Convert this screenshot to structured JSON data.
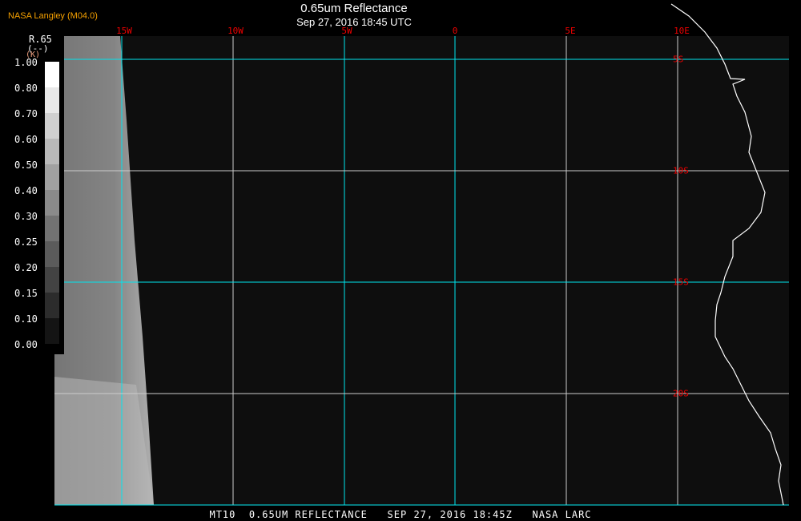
{
  "credit": "NASA Langley (M04.0)",
  "title": "0.65um Reflectance",
  "subtitle": "Sep 27, 2016 18:45 UTC",
  "legend": {
    "var": "R.65",
    "units": "(--)",
    "sub": "(K)",
    "values": [
      "1.00",
      "0.80",
      "0.70",
      "0.60",
      "0.50",
      "0.40",
      "0.30",
      "0.25",
      "0.20",
      "0.15",
      "0.10",
      "0.00"
    ]
  },
  "lon_labels": [
    "15W",
    "10W",
    "5W",
    "0",
    "5E",
    "10E"
  ],
  "lat_labels": [
    "5S",
    "10S",
    "15S",
    "20S"
  ],
  "footer": "MT10  0.65UM REFLECTANCE   SEP 27, 2016 18:45Z   NASA LARC",
  "colors": {
    "grid_major": "#00e5ee",
    "grid_minor": "#cccccc",
    "label": "#ee0000",
    "credit": "#f5a000"
  }
}
